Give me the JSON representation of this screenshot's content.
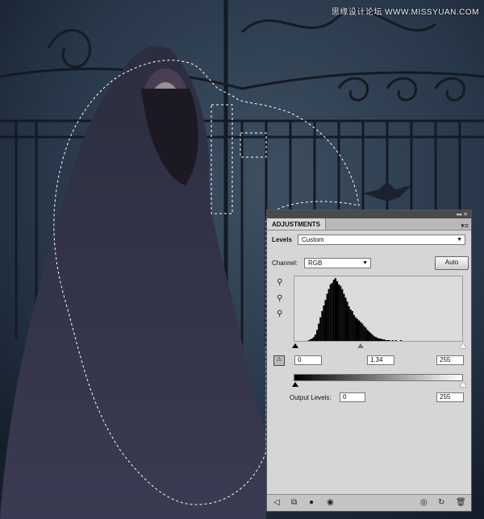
{
  "watermark": "思缘设计论坛 WWW.MISSYUAN.COM",
  "panel": {
    "tab_label": "ADJUSTMENTS",
    "collapse_glyph": "◂◂",
    "close_glyph": "✕",
    "menu_glyph": "▾≡",
    "levels_label": "Levels",
    "preset_value": "Custom",
    "channel_label": "Channel:",
    "channel_value": "RGB",
    "auto_label": "Auto",
    "input_black": "0",
    "input_gamma": "1.34",
    "input_white": "255",
    "output_label": "Output Levels:",
    "output_black": "0",
    "output_white": "255"
  },
  "icons": {
    "eyedropper_black": "eyedropper-black-icon",
    "eyedropper_gray": "eyedropper-gray-icon",
    "eyedropper_white": "eyedropper-white-icon",
    "calc_histogram": "calculate-histogram-icon",
    "back": "back-arrow-icon",
    "clip": "clip-to-layer-icon",
    "mask": "layer-visibility-mask-icon",
    "eye": "eye-icon",
    "view_prev": "view-previous-icon",
    "reset": "reset-icon",
    "trash": "trash-icon"
  },
  "histogram": [
    0,
    0,
    0,
    0,
    0,
    0,
    0,
    0,
    1,
    2,
    3,
    5,
    8,
    14,
    22,
    30,
    38,
    45,
    52,
    60,
    66,
    72,
    74,
    78,
    80,
    76,
    72,
    70,
    66,
    60,
    55,
    50,
    44,
    40,
    38,
    33,
    30,
    28,
    26,
    24,
    22,
    19,
    17,
    14,
    12,
    10,
    8,
    6,
    5,
    4,
    3,
    3,
    2,
    2,
    1,
    1,
    1,
    0,
    1,
    0,
    1,
    0,
    0,
    1,
    0,
    0,
    0,
    0,
    0,
    0,
    0,
    0,
    0,
    0,
    0,
    0,
    0,
    0,
    0,
    0,
    0,
    0,
    0,
    0,
    0,
    0,
    0,
    0,
    0,
    0,
    0,
    0,
    0,
    0,
    0,
    0,
    0,
    0,
    0,
    0
  ]
}
